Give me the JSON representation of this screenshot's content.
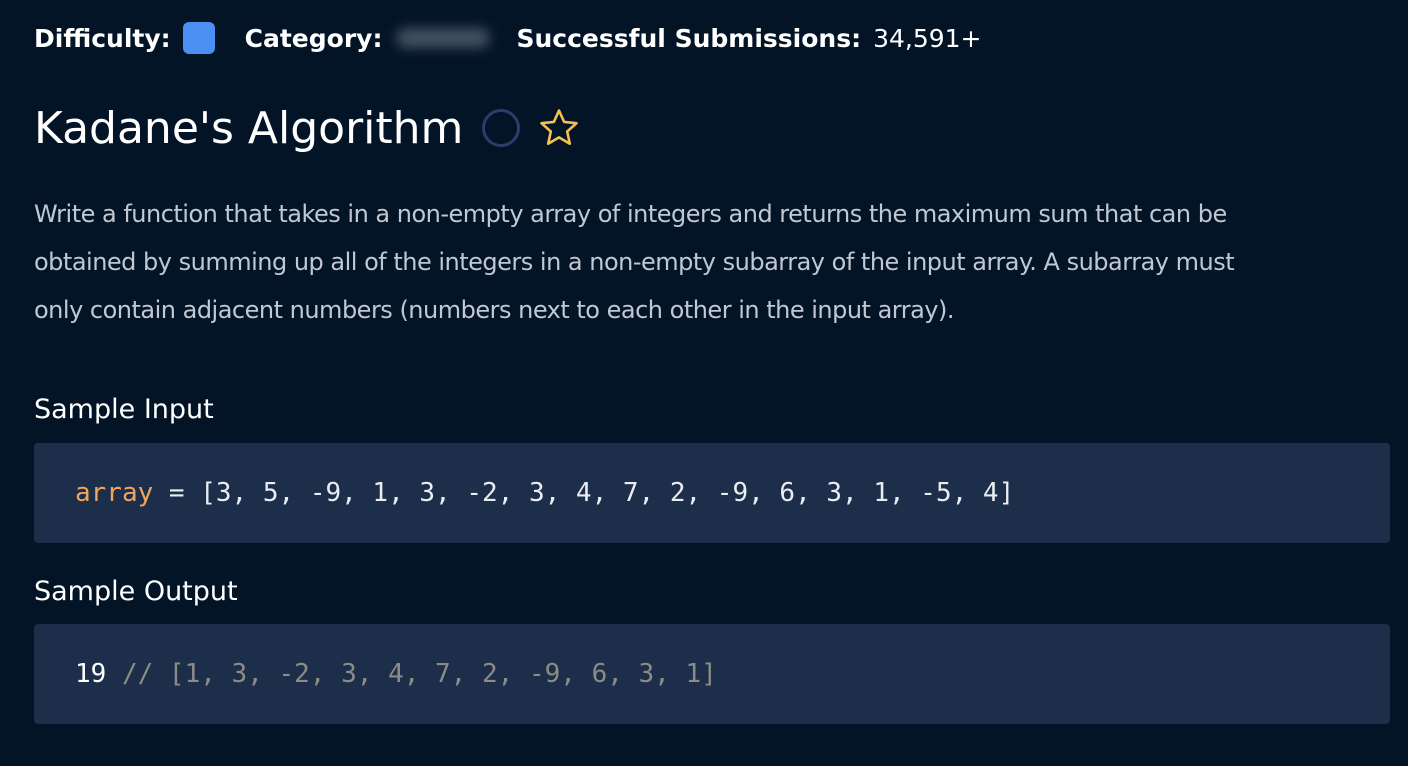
{
  "meta": {
    "difficulty_label": "Difficulty:",
    "difficulty_color": "#4c8ff3",
    "category_label": "Category:",
    "submissions_label": "Successful Submissions:",
    "submissions_value": "34,591+"
  },
  "problem": {
    "title": "Kadane's Algorithm",
    "completion_icon": "circle-outline-icon",
    "favorite_icon": "star-outline-icon",
    "description_lines": [
      "Write a function that takes in a non-empty array of integers and returns the maximum sum that can be",
      "obtained by summing up all of the integers in a non-empty subarray of the input array. A subarray must",
      "only contain adjacent numbers (numbers next to each other in the input array)."
    ]
  },
  "sample_input": {
    "heading": "Sample Input",
    "var_name": "array",
    "operator": " = ",
    "value": "[3, 5, -9, 1, 3, -2, 3, 4, 7, 2, -9, 6, 3, 1, -5, 4]"
  },
  "sample_output": {
    "heading": "Sample Output",
    "result": "19",
    "comment": " // [1, 3, -2, 3, 4, 7, 2, -9, 6, 3, 1]"
  },
  "colors": {
    "background": "#031427",
    "code_background": "#1c2e49",
    "variable": "#f0a45d",
    "comment": "#8c8c86",
    "star": "#f2c14e",
    "circle": "#2b3d6e"
  }
}
